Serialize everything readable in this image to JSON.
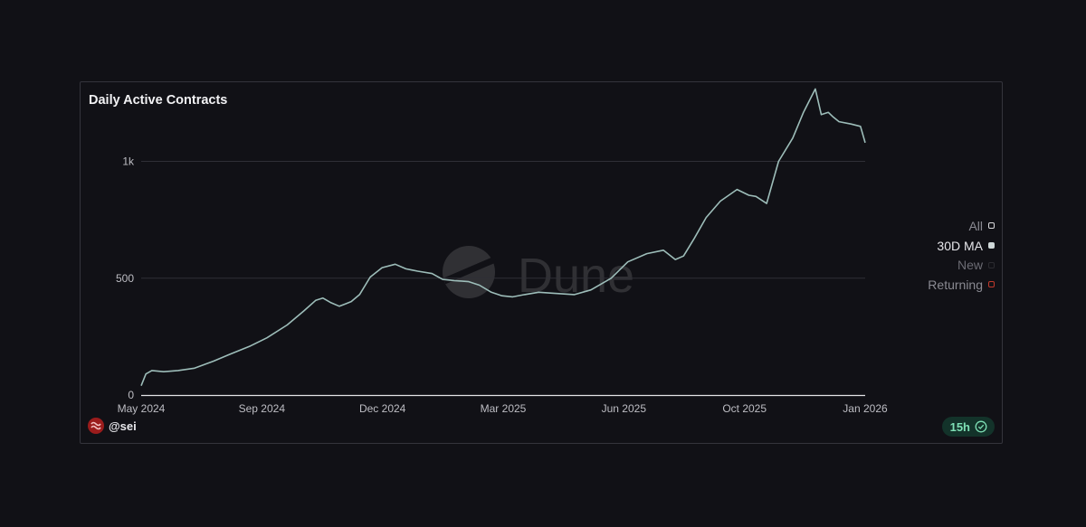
{
  "card": {
    "title": "Daily Active Contracts",
    "watermark": "Dune",
    "author": "@sei",
    "freshness": "15h",
    "icons": {
      "avatar": "sei-logo-icon",
      "freshness": "check-circle-icon",
      "watermark": "dune-logo-icon"
    }
  },
  "colors": {
    "line": "#9dbdb9",
    "grid": "#2f2f36",
    "axis": "#e3e3e6",
    "returning": "#c0392b"
  },
  "legend": [
    {
      "label": "All",
      "active": false,
      "color": "#d9d9dc",
      "text_color": "#8a8a92"
    },
    {
      "label": "30D MA",
      "active": true,
      "color": "#cfd8d8",
      "text_color": "#e6e6ea"
    },
    {
      "label": "New",
      "active": false,
      "color": "#2b2b30",
      "text_color": "#6c6c74"
    },
    {
      "label": "Returning",
      "active": false,
      "color": "#c0392b",
      "text_color": "#8a8a92"
    }
  ],
  "chart_data": {
    "type": "line",
    "title": "Daily Active Contracts",
    "xlabel": "",
    "ylabel": "",
    "ylim": [
      0,
      1300
    ],
    "xlim": [
      "2024-05-01",
      "2026-01-01"
    ],
    "grid": true,
    "legend_position": "right",
    "x_ticks": [
      "May 2024",
      "Sep 2024",
      "Dec 2024",
      "Mar 2025",
      "Jun 2025",
      "Oct 2025",
      "Jan 2026"
    ],
    "y_ticks": [
      {
        "value": 0,
        "label": "0"
      },
      {
        "value": 500,
        "label": "500"
      },
      {
        "value": 1000,
        "label": "1k"
      }
    ],
    "series": [
      {
        "name": "30D MA",
        "x": [
          "2024-05-01",
          "2024-05-05",
          "2024-05-10",
          "2024-05-20",
          "2024-06-01",
          "2024-06-15",
          "2024-07-01",
          "2024-07-15",
          "2024-08-01",
          "2024-08-15",
          "2024-09-01",
          "2024-09-15",
          "2024-09-25",
          "2024-10-01",
          "2024-10-08",
          "2024-10-15",
          "2024-10-20",
          "2024-10-25",
          "2024-11-01",
          "2024-11-10",
          "2024-11-20",
          "2024-12-01",
          "2024-12-10",
          "2024-12-15",
          "2024-12-20",
          "2025-01-01",
          "2025-01-10",
          "2025-01-20",
          "2025-02-01",
          "2025-02-10",
          "2025-02-20",
          "2025-03-01",
          "2025-03-10",
          "2025-03-20",
          "2025-04-01",
          "2025-04-15",
          "2025-05-01",
          "2025-05-15",
          "2025-06-01",
          "2025-06-15",
          "2025-07-01",
          "2025-07-15",
          "2025-07-25",
          "2025-08-01",
          "2025-08-10",
          "2025-08-20",
          "2025-09-01",
          "2025-09-15",
          "2025-09-25",
          "2025-10-01",
          "2025-10-10",
          "2025-10-20",
          "2025-11-01",
          "2025-11-10",
          "2025-11-20",
          "2025-11-25",
          "2025-12-01",
          "2025-12-05",
          "2025-12-10",
          "2025-12-20",
          "2025-12-28",
          "2026-01-01"
        ],
        "values": [
          40,
          90,
          105,
          100,
          105,
          115,
          145,
          175,
          210,
          245,
          300,
          360,
          405,
          415,
          395,
          380,
          390,
          400,
          430,
          505,
          545,
          560,
          540,
          535,
          530,
          520,
          495,
          490,
          485,
          470,
          440,
          425,
          420,
          430,
          440,
          435,
          430,
          450,
          500,
          570,
          605,
          620,
          580,
          595,
          670,
          760,
          830,
          880,
          855,
          850,
          820,
          1000,
          1100,
          1210,
          1310,
          1200,
          1210,
          1190,
          1170,
          1160,
          1150,
          1080
        ]
      }
    ]
  }
}
